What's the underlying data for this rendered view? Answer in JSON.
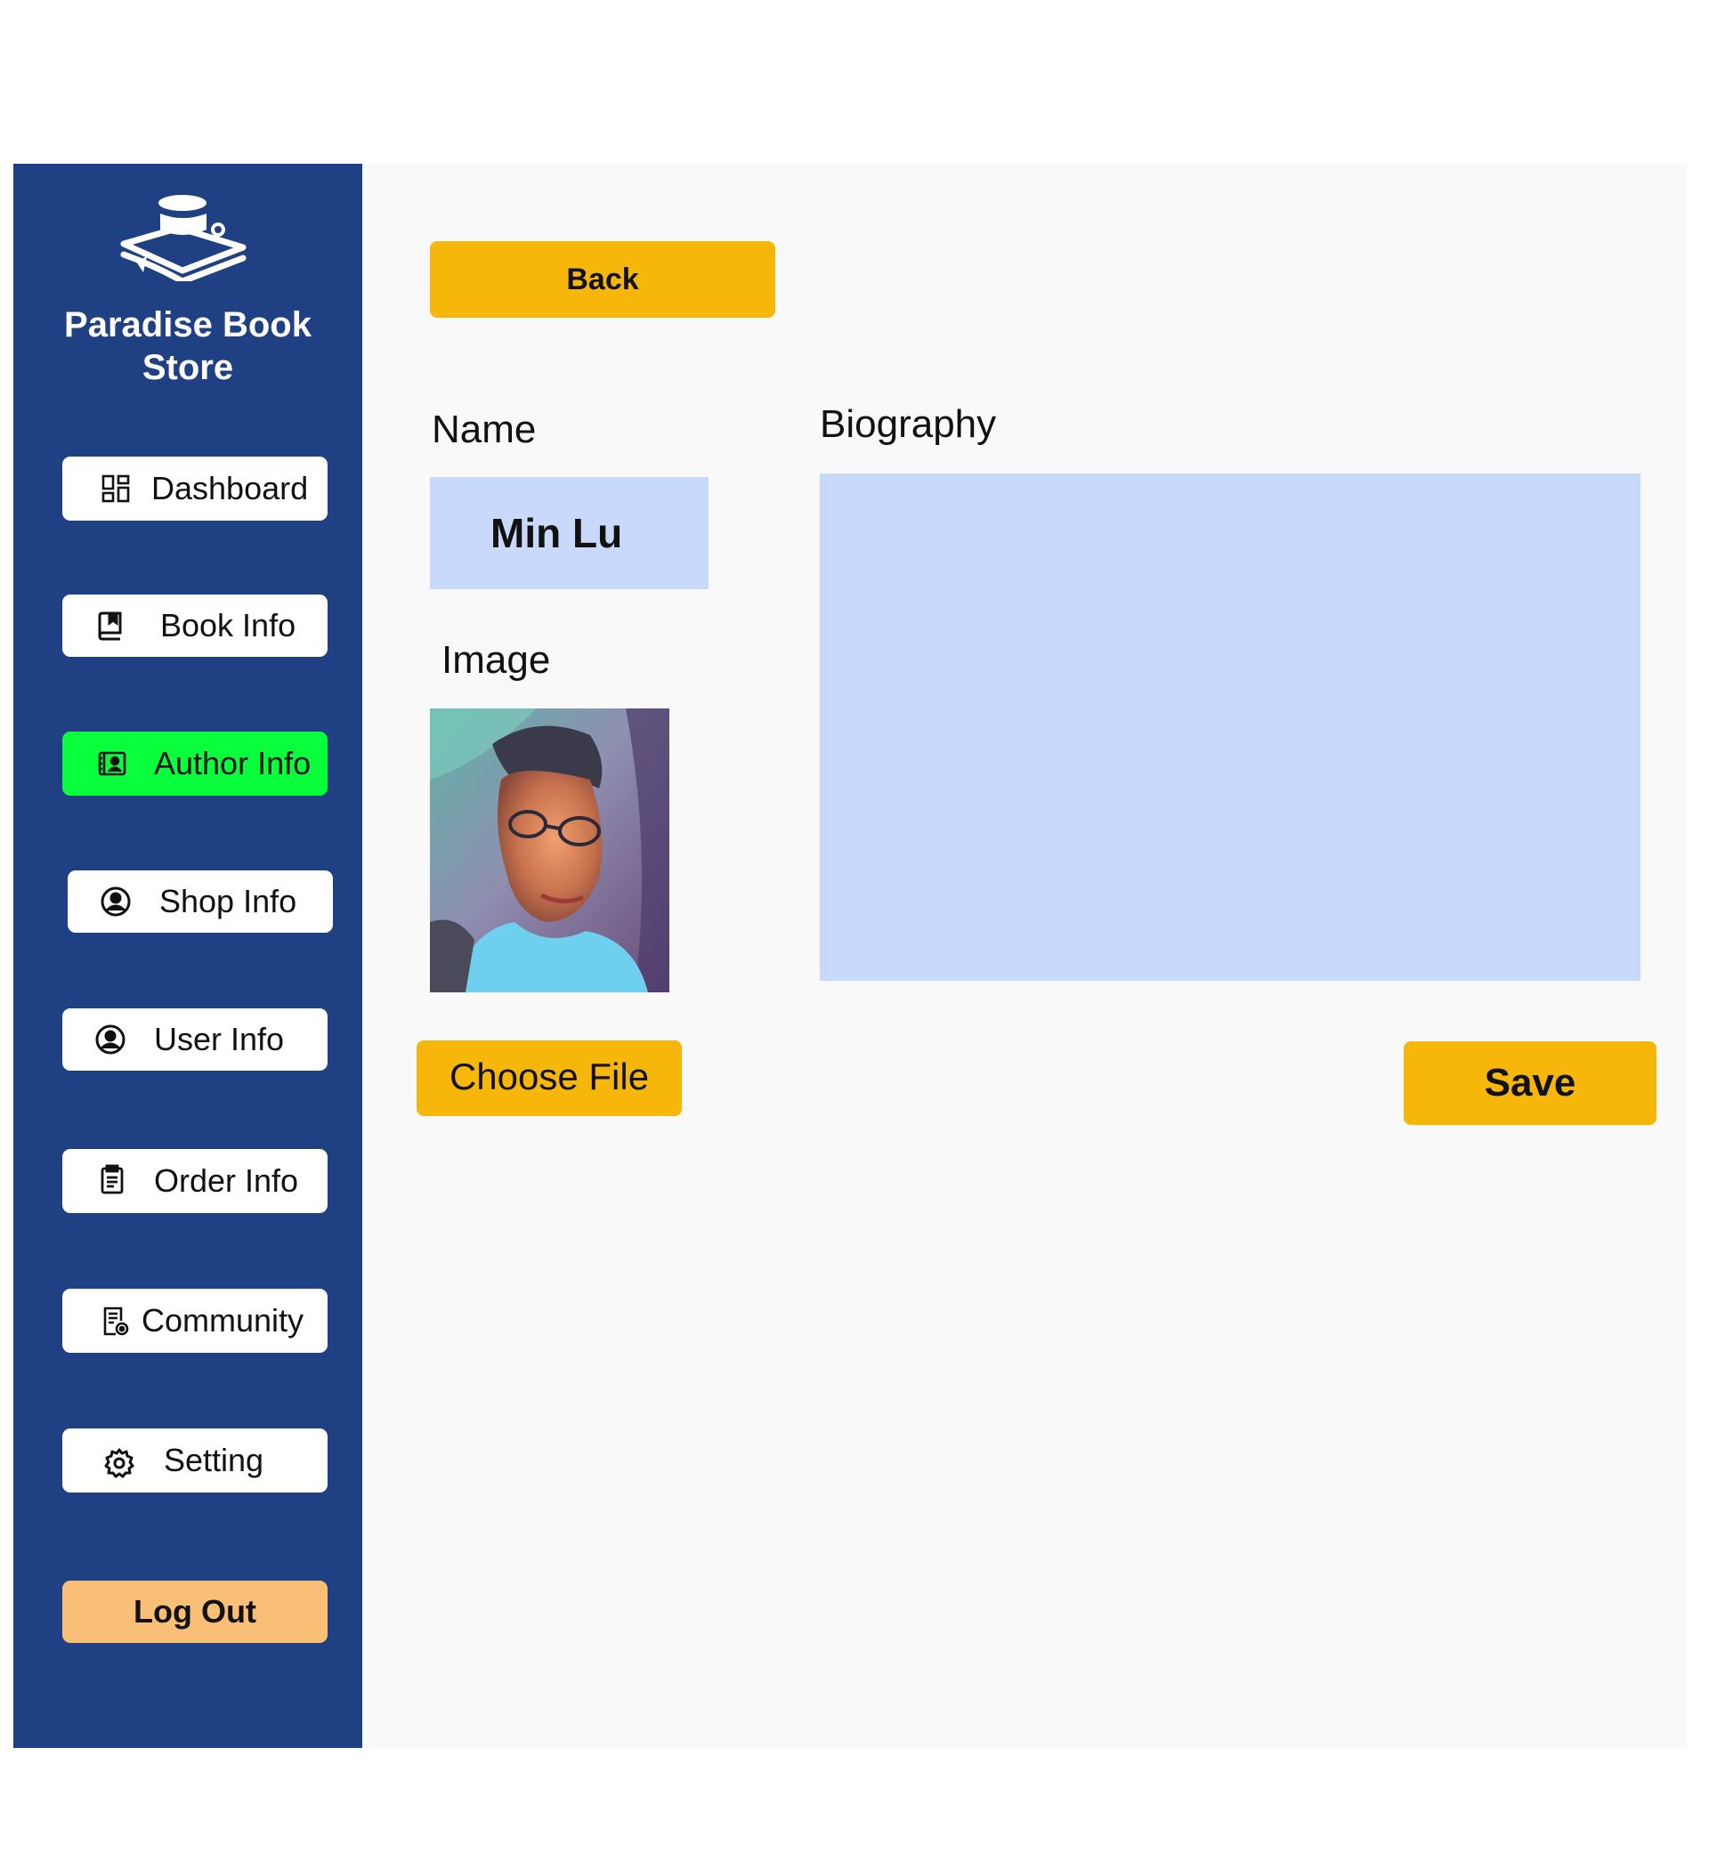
{
  "brand": {
    "name": "Paradise Book Store",
    "logo_icon": "book-stack-logo-icon"
  },
  "sidebar": {
    "items": [
      {
        "label": "Dashboard",
        "icon": "dashboard-icon"
      },
      {
        "label": "Book Info",
        "icon": "book-icon"
      },
      {
        "label": "Author Info",
        "icon": "author-card-icon",
        "active": true
      },
      {
        "label": "Shop Info",
        "icon": "user-circle-icon"
      },
      {
        "label": "User Info",
        "icon": "user-circle-icon"
      },
      {
        "label": "Order Info",
        "icon": "clipboard-icon"
      },
      {
        "label": "Community",
        "icon": "document-view-icon"
      },
      {
        "label": "Setting",
        "icon": "gear-icon"
      }
    ],
    "logout_label": "Log Out"
  },
  "main": {
    "back_label": "Back",
    "name_label": "Name",
    "name_value": "Min Lu",
    "image_label": "Image",
    "choose_file_label": "Choose File",
    "biography_label": "Biography",
    "biography_value": "",
    "save_label": "Save"
  },
  "colors": {
    "sidebar_bg": "#1f4183",
    "active_nav": "#09ff3c",
    "accent_button": "#f7b60a",
    "logout_button": "#f9bf77",
    "input_bg": "#c8d9fb",
    "main_bg": "#f9f9f9"
  }
}
